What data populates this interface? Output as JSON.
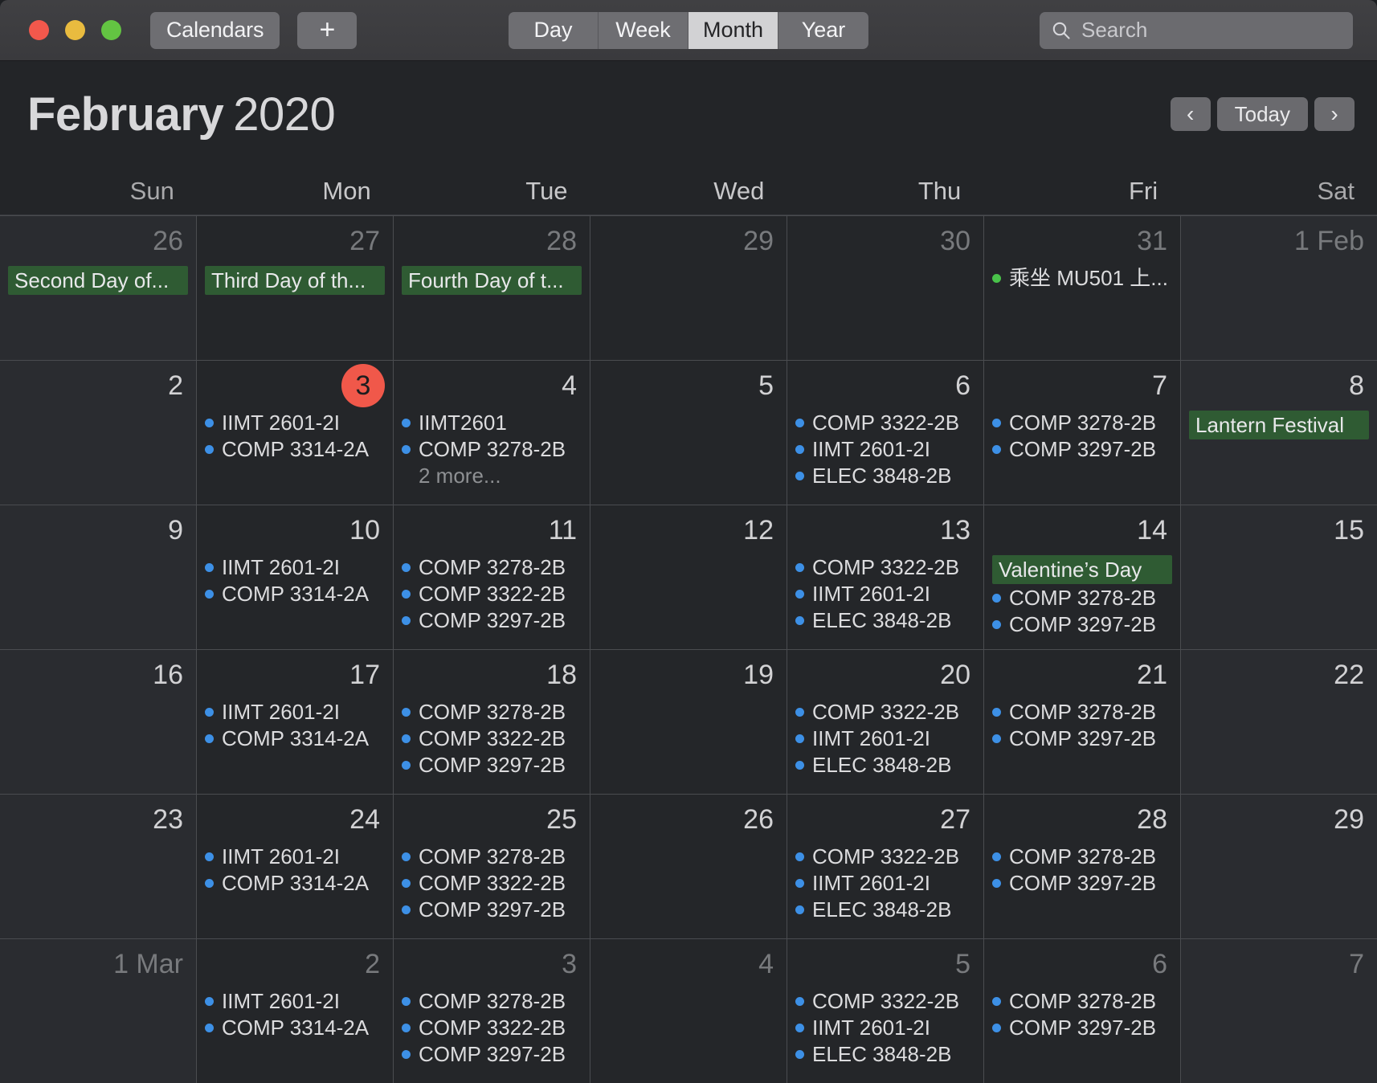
{
  "window": {
    "traffic_lights": [
      "close",
      "minimize",
      "zoom"
    ],
    "calendars_button": "Calendars",
    "add_button": "+",
    "view_tabs": [
      {
        "label": "Day",
        "active": false
      },
      {
        "label": "Week",
        "active": false
      },
      {
        "label": "Month",
        "active": true
      },
      {
        "label": "Year",
        "active": false
      }
    ],
    "search": {
      "placeholder": "Search",
      "value": ""
    }
  },
  "header": {
    "month": "February",
    "year": "2020",
    "prev_label": "‹",
    "today_label": "Today",
    "next_label": "›"
  },
  "weekdays": [
    "Sun",
    "Mon",
    "Tue",
    "Wed",
    "Thu",
    "Fri",
    "Sat"
  ],
  "colors": {
    "today_badge": "#f0584a",
    "event_dot_blue": "#3d90e6",
    "event_dot_green": "#49c24a",
    "holiday_banner": "#2f5b33",
    "window_chrome": "#3c3c3f",
    "grid_background": "#242629",
    "weekend_background": "#2a2c30"
  },
  "weeks": [
    [
      {
        "day": "26",
        "out": true,
        "weekend": true,
        "today": false,
        "events": [
          {
            "type": "banner",
            "label": "Second Day of..."
          }
        ]
      },
      {
        "day": "27",
        "out": true,
        "weekend": false,
        "today": false,
        "events": [
          {
            "type": "banner",
            "label": "Third Day of th..."
          }
        ]
      },
      {
        "day": "28",
        "out": true,
        "weekend": false,
        "today": false,
        "events": [
          {
            "type": "banner",
            "label": "Fourth Day of t..."
          }
        ]
      },
      {
        "day": "29",
        "out": true,
        "weekend": false,
        "today": false,
        "events": []
      },
      {
        "day": "30",
        "out": true,
        "weekend": false,
        "today": false,
        "events": []
      },
      {
        "day": "31",
        "out": true,
        "weekend": false,
        "today": false,
        "events": [
          {
            "type": "dot",
            "color": "green",
            "label": "乘坐 MU501 上..."
          }
        ]
      },
      {
        "day": "1 Feb",
        "out": true,
        "weekend": true,
        "today": false,
        "events": []
      }
    ],
    [
      {
        "day": "2",
        "out": false,
        "weekend": true,
        "today": false,
        "events": []
      },
      {
        "day": "3",
        "out": false,
        "weekend": false,
        "today": true,
        "events": [
          {
            "type": "dot",
            "color": "blue",
            "label": "IIMT 2601-2I"
          },
          {
            "type": "dot",
            "color": "blue",
            "label": "COMP 3314-2A"
          }
        ]
      },
      {
        "day": "4",
        "out": false,
        "weekend": false,
        "today": false,
        "events": [
          {
            "type": "dot",
            "color": "blue",
            "label": "IIMT2601"
          },
          {
            "type": "dot",
            "color": "blue",
            "label": "COMP 3278-2B"
          },
          {
            "type": "more",
            "label": "2 more..."
          }
        ]
      },
      {
        "day": "5",
        "out": false,
        "weekend": false,
        "today": false,
        "events": []
      },
      {
        "day": "6",
        "out": false,
        "weekend": false,
        "today": false,
        "events": [
          {
            "type": "dot",
            "color": "blue",
            "label": "COMP 3322-2B"
          },
          {
            "type": "dot",
            "color": "blue",
            "label": "IIMT 2601-2I"
          },
          {
            "type": "dot",
            "color": "blue",
            "label": "ELEC 3848-2B"
          }
        ]
      },
      {
        "day": "7",
        "out": false,
        "weekend": false,
        "today": false,
        "events": [
          {
            "type": "dot",
            "color": "blue",
            "label": "COMP 3278-2B"
          },
          {
            "type": "dot",
            "color": "blue",
            "label": "COMP 3297-2B"
          }
        ]
      },
      {
        "day": "8",
        "out": false,
        "weekend": true,
        "today": false,
        "events": [
          {
            "type": "banner",
            "label": "Lantern Festival"
          }
        ]
      }
    ],
    [
      {
        "day": "9",
        "out": false,
        "weekend": true,
        "today": false,
        "events": []
      },
      {
        "day": "10",
        "out": false,
        "weekend": false,
        "today": false,
        "events": [
          {
            "type": "dot",
            "color": "blue",
            "label": "IIMT 2601-2I"
          },
          {
            "type": "dot",
            "color": "blue",
            "label": "COMP 3314-2A"
          }
        ]
      },
      {
        "day": "11",
        "out": false,
        "weekend": false,
        "today": false,
        "events": [
          {
            "type": "dot",
            "color": "blue",
            "label": "COMP 3278-2B"
          },
          {
            "type": "dot",
            "color": "blue",
            "label": "COMP 3322-2B"
          },
          {
            "type": "dot",
            "color": "blue",
            "label": "COMP 3297-2B"
          }
        ]
      },
      {
        "day": "12",
        "out": false,
        "weekend": false,
        "today": false,
        "events": []
      },
      {
        "day": "13",
        "out": false,
        "weekend": false,
        "today": false,
        "events": [
          {
            "type": "dot",
            "color": "blue",
            "label": "COMP 3322-2B"
          },
          {
            "type": "dot",
            "color": "blue",
            "label": "IIMT 2601-2I"
          },
          {
            "type": "dot",
            "color": "blue",
            "label": "ELEC 3848-2B"
          }
        ]
      },
      {
        "day": "14",
        "out": false,
        "weekend": false,
        "today": false,
        "events": [
          {
            "type": "banner",
            "label": "Valentine’s Day"
          },
          {
            "type": "dot",
            "color": "blue",
            "label": "COMP 3278-2B"
          },
          {
            "type": "dot",
            "color": "blue",
            "label": "COMP 3297-2B"
          }
        ]
      },
      {
        "day": "15",
        "out": false,
        "weekend": true,
        "today": false,
        "events": []
      }
    ],
    [
      {
        "day": "16",
        "out": false,
        "weekend": true,
        "today": false,
        "events": []
      },
      {
        "day": "17",
        "out": false,
        "weekend": false,
        "today": false,
        "events": [
          {
            "type": "dot",
            "color": "blue",
            "label": "IIMT 2601-2I"
          },
          {
            "type": "dot",
            "color": "blue",
            "label": "COMP 3314-2A"
          }
        ]
      },
      {
        "day": "18",
        "out": false,
        "weekend": false,
        "today": false,
        "events": [
          {
            "type": "dot",
            "color": "blue",
            "label": "COMP 3278-2B"
          },
          {
            "type": "dot",
            "color": "blue",
            "label": "COMP 3322-2B"
          },
          {
            "type": "dot",
            "color": "blue",
            "label": "COMP 3297-2B"
          }
        ]
      },
      {
        "day": "19",
        "out": false,
        "weekend": false,
        "today": false,
        "events": []
      },
      {
        "day": "20",
        "out": false,
        "weekend": false,
        "today": false,
        "events": [
          {
            "type": "dot",
            "color": "blue",
            "label": "COMP 3322-2B"
          },
          {
            "type": "dot",
            "color": "blue",
            "label": "IIMT 2601-2I"
          },
          {
            "type": "dot",
            "color": "blue",
            "label": "ELEC 3848-2B"
          }
        ]
      },
      {
        "day": "21",
        "out": false,
        "weekend": false,
        "today": false,
        "events": [
          {
            "type": "dot",
            "color": "blue",
            "label": "COMP 3278-2B"
          },
          {
            "type": "dot",
            "color": "blue",
            "label": "COMP 3297-2B"
          }
        ]
      },
      {
        "day": "22",
        "out": false,
        "weekend": true,
        "today": false,
        "events": []
      }
    ],
    [
      {
        "day": "23",
        "out": false,
        "weekend": true,
        "today": false,
        "events": []
      },
      {
        "day": "24",
        "out": false,
        "weekend": false,
        "today": false,
        "events": [
          {
            "type": "dot",
            "color": "blue",
            "label": "IIMT 2601-2I"
          },
          {
            "type": "dot",
            "color": "blue",
            "label": "COMP 3314-2A"
          }
        ]
      },
      {
        "day": "25",
        "out": false,
        "weekend": false,
        "today": false,
        "events": [
          {
            "type": "dot",
            "color": "blue",
            "label": "COMP 3278-2B"
          },
          {
            "type": "dot",
            "color": "blue",
            "label": "COMP 3322-2B"
          },
          {
            "type": "dot",
            "color": "blue",
            "label": "COMP 3297-2B"
          }
        ]
      },
      {
        "day": "26",
        "out": false,
        "weekend": false,
        "today": false,
        "events": []
      },
      {
        "day": "27",
        "out": false,
        "weekend": false,
        "today": false,
        "events": [
          {
            "type": "dot",
            "color": "blue",
            "label": "COMP 3322-2B"
          },
          {
            "type": "dot",
            "color": "blue",
            "label": "IIMT 2601-2I"
          },
          {
            "type": "dot",
            "color": "blue",
            "label": "ELEC 3848-2B"
          }
        ]
      },
      {
        "day": "28",
        "out": false,
        "weekend": false,
        "today": false,
        "events": [
          {
            "type": "dot",
            "color": "blue",
            "label": "COMP 3278-2B"
          },
          {
            "type": "dot",
            "color": "blue",
            "label": "COMP 3297-2B"
          }
        ]
      },
      {
        "day": "29",
        "out": false,
        "weekend": true,
        "today": false,
        "events": []
      }
    ],
    [
      {
        "day": "1 Mar",
        "out": true,
        "weekend": true,
        "today": false,
        "events": []
      },
      {
        "day": "2",
        "out": true,
        "weekend": false,
        "today": false,
        "events": [
          {
            "type": "dot",
            "color": "blue",
            "label": "IIMT 2601-2I"
          },
          {
            "type": "dot",
            "color": "blue",
            "label": "COMP 3314-2A"
          }
        ]
      },
      {
        "day": "3",
        "out": true,
        "weekend": false,
        "today": false,
        "events": [
          {
            "type": "dot",
            "color": "blue",
            "label": "COMP 3278-2B"
          },
          {
            "type": "dot",
            "color": "blue",
            "label": "COMP 3322-2B"
          },
          {
            "type": "dot",
            "color": "blue",
            "label": "COMP 3297-2B"
          }
        ]
      },
      {
        "day": "4",
        "out": true,
        "weekend": false,
        "today": false,
        "events": []
      },
      {
        "day": "5",
        "out": true,
        "weekend": false,
        "today": false,
        "events": [
          {
            "type": "dot",
            "color": "blue",
            "label": "COMP 3322-2B"
          },
          {
            "type": "dot",
            "color": "blue",
            "label": "IIMT 2601-2I"
          },
          {
            "type": "dot",
            "color": "blue",
            "label": "ELEC 3848-2B"
          }
        ]
      },
      {
        "day": "6",
        "out": true,
        "weekend": false,
        "today": false,
        "events": [
          {
            "type": "dot",
            "color": "blue",
            "label": "COMP 3278-2B"
          },
          {
            "type": "dot",
            "color": "blue",
            "label": "COMP 3297-2B"
          }
        ]
      },
      {
        "day": "7",
        "out": true,
        "weekend": true,
        "today": false,
        "events": []
      }
    ]
  ]
}
